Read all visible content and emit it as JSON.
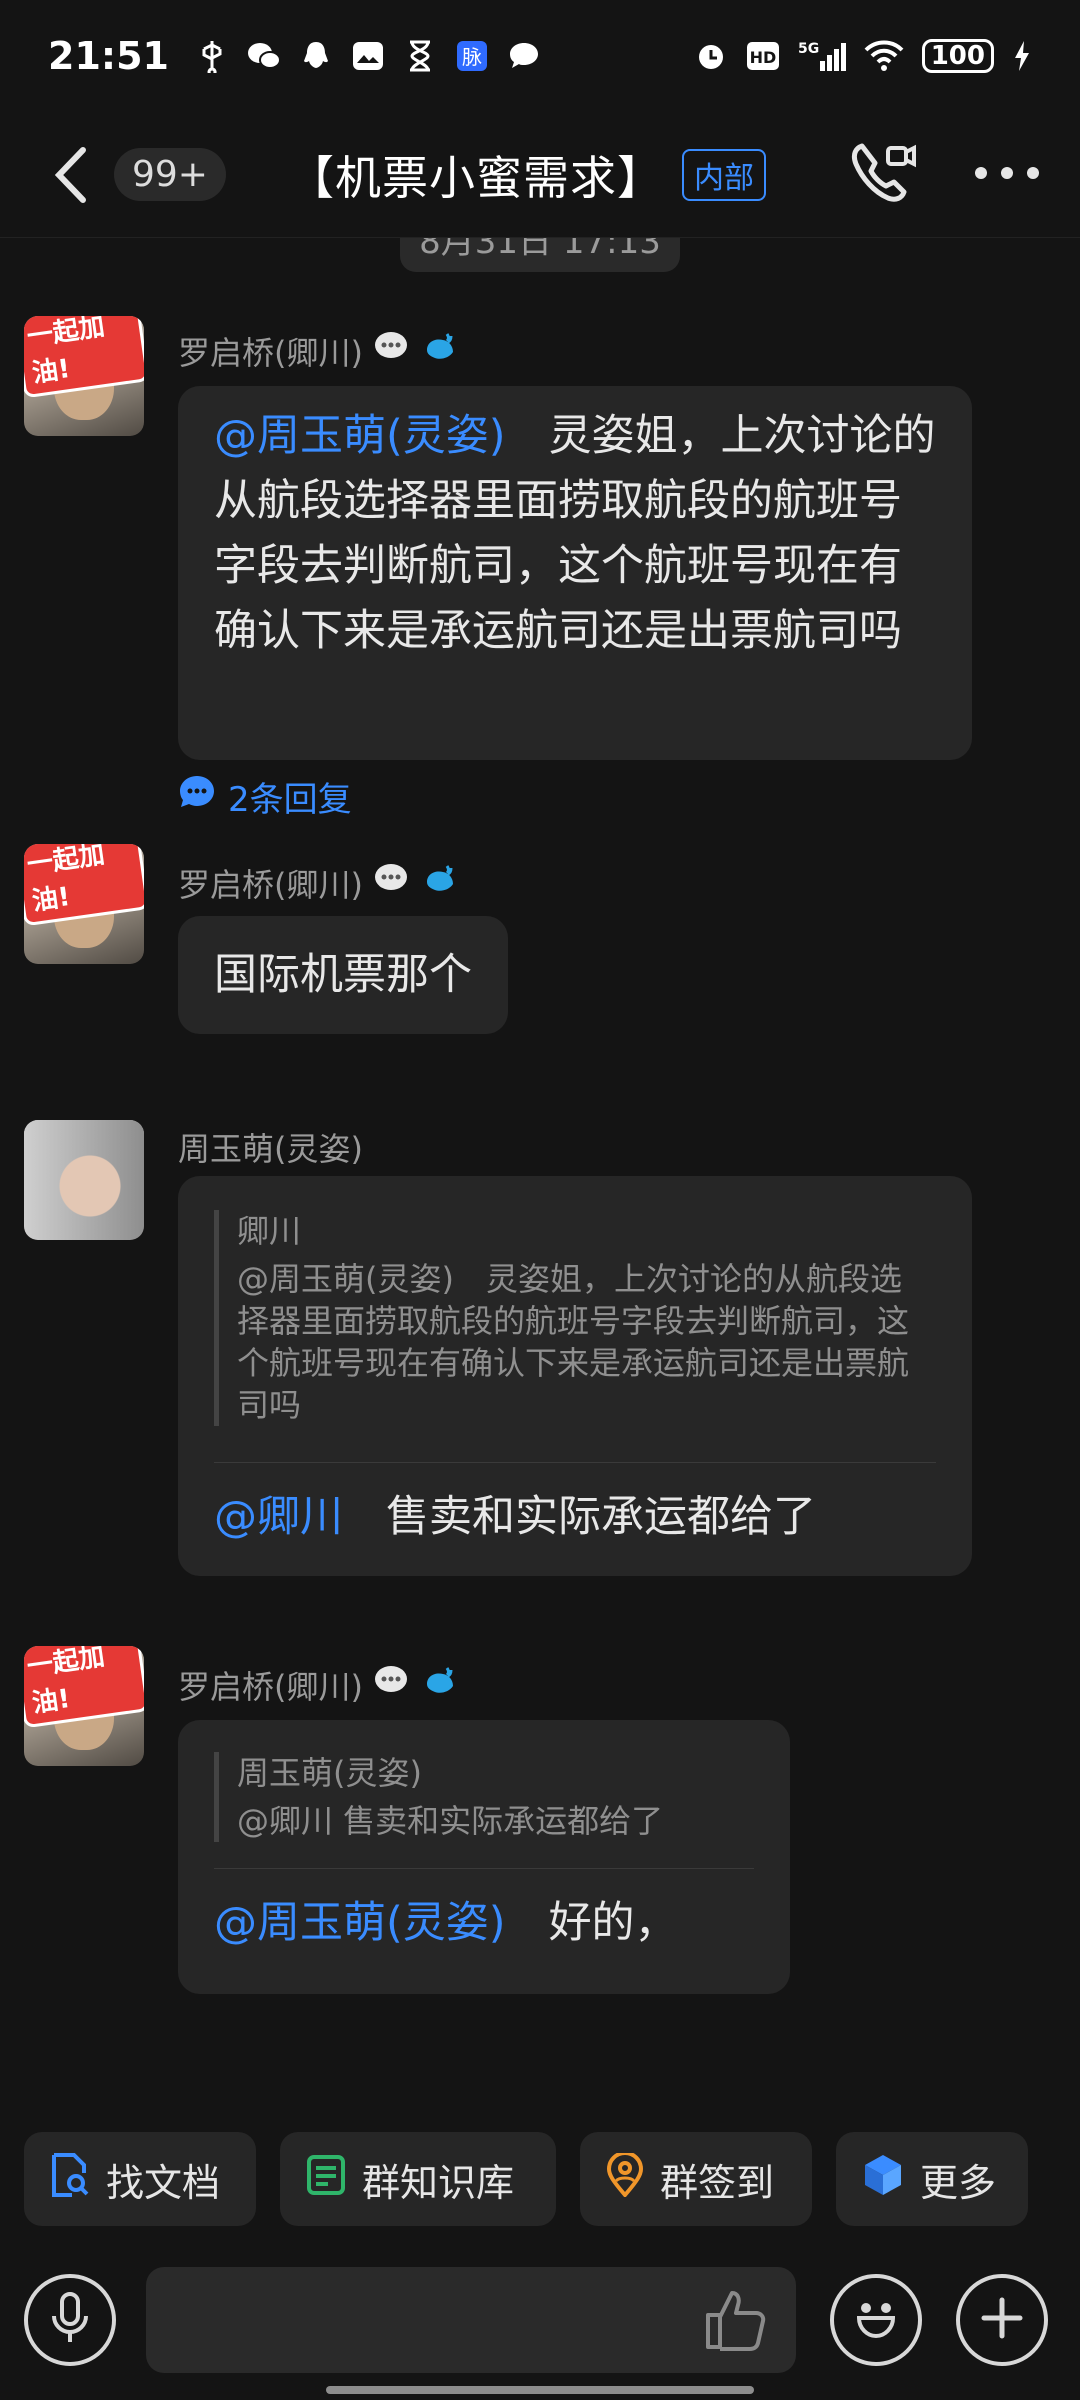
{
  "status_bar": {
    "time": "21:51",
    "battery": "100",
    "network": "5G"
  },
  "header": {
    "unread": "99+",
    "title": "【机票小蜜需求】",
    "badge": "内部"
  },
  "timestamp": "8月31日 17:13",
  "messages": [
    {
      "sender": "罗启桥(卿川)",
      "mention": "@周玉萌(灵姿)",
      "text": "灵姿姐，上次讨论的从航段选择器里面捞取航段的航班号字段去判断航司，这个航班号现在有确认下来是承运航司还是出票航司吗",
      "replies": "2条回复"
    },
    {
      "sender": "罗启桥(卿川)",
      "text": "国际机票那个"
    },
    {
      "sender": "周玉萌(灵姿)",
      "quote_author": "卿川",
      "quote_text": "@周玉萌(灵姿)　灵姿姐，上次讨论的从航段选择器里面捞取航段的航班号字段去判断航司，这个航班号现在有确认下来是承运航司还是出票航司吗",
      "mention": "@卿川",
      "text": "售卖和实际承运都给了"
    },
    {
      "sender": "罗启桥(卿川)",
      "quote_author": "周玉萌(灵姿)",
      "quote_text": "@卿川  售卖和实际承运都给了",
      "mention": "@周玉萌(灵姿)",
      "text": "好的，"
    }
  ],
  "avatar_sticker": "一起加油!",
  "shortcuts": [
    {
      "label": "找文档",
      "icon": "doc-search-icon"
    },
    {
      "label": "群知识库",
      "icon": "knowledge-base-icon"
    },
    {
      "label": "群签到",
      "icon": "checkin-icon"
    },
    {
      "label": "更多",
      "icon": "more-apps-icon"
    }
  ],
  "colors": {
    "background": "#141414",
    "bubble": "#262626",
    "accent": "#3a8cff"
  }
}
